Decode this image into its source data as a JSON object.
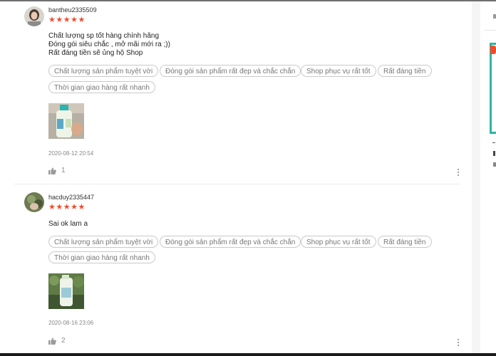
{
  "reviews": [
    {
      "username": "bantheu2335509",
      "stars": "★★★★★",
      "lines": [
        "Chất lượng sp tốt hàng chính hãng",
        "Đóng gói siêu chắc , mở mãi mới ra ;))",
        "Rất đáng tiền sẽ ủng hộ Shop"
      ],
      "tags": [
        "Chất lượng sản phẩm tuyệt vời",
        "Đóng gói sản phẩm rất đẹp và chắc chắn",
        "Shop phục vụ rất tốt",
        "Rất đáng tiền",
        "Thời gian giao hàng rất nhanh"
      ],
      "date": "2020-08-12 20:54",
      "likes": "1"
    },
    {
      "username": "hacduy2335447",
      "stars": "★★★★★",
      "lines": [
        "Sai ok lam a"
      ],
      "tags": [
        "Chất lượng sản phẩm tuyệt vời",
        "Đóng gói sản phẩm rất đẹp và chắc chắn",
        "Shop phục vụ rất tốt",
        "Rất đáng tiền",
        "Thời gian giao hàng rất nhanh"
      ],
      "date": "2020-08-16 23:06",
      "likes": "2"
    }
  ],
  "colors": {
    "star": "#ee4d2d",
    "teal_border": "#2fb5a0",
    "badge": "#ee4d2d"
  }
}
